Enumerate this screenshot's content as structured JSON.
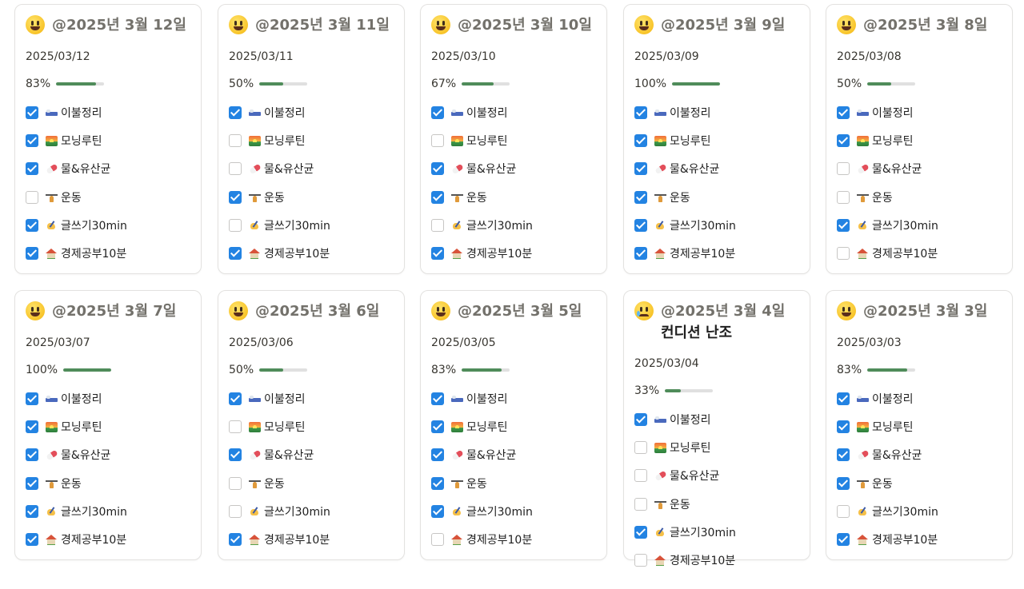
{
  "checklist_items": [
    {
      "label": "이불정리",
      "icon": "bed-icon"
    },
    {
      "label": "모닝루틴",
      "icon": "sunrise-icon"
    },
    {
      "label": "물&유산균",
      "icon": "pill-icon"
    },
    {
      "label": "운동",
      "icon": "weight-lifter-icon"
    },
    {
      "label": "글쓰기30min",
      "icon": "writing-hand-icon"
    },
    {
      "label": "경제공부10분",
      "icon": "house-icon"
    }
  ],
  "colors": {
    "checkbox_checked": "#2383e2",
    "progress_fill": "#4f8c5a",
    "progress_track": "#e0e0e0",
    "title_gray": "#73716b"
  },
  "cards": [
    {
      "title": "@2025년 3월 12일",
      "title_suffix": "",
      "mood": "grinning-face-icon",
      "date": "2025/03/12",
      "progress_label": "83%",
      "progress": 0.83,
      "checks": [
        true,
        true,
        true,
        false,
        true,
        true
      ]
    },
    {
      "title": "@2025년 3월 11일",
      "title_suffix": "",
      "mood": "grinning-face-icon",
      "date": "2025/03/11",
      "progress_label": "50%",
      "progress": 0.5,
      "checks": [
        true,
        false,
        false,
        true,
        false,
        true
      ]
    },
    {
      "title": "@2025년 3월 10일",
      "title_suffix": "",
      "mood": "grinning-face-icon",
      "date": "2025/03/10",
      "progress_label": "67%",
      "progress": 0.67,
      "checks": [
        true,
        false,
        true,
        true,
        false,
        true
      ]
    },
    {
      "title": "@2025년 3월 9일",
      "title_suffix": "",
      "mood": "grinning-face-icon",
      "date": "2025/03/09",
      "progress_label": "100%",
      "progress": 1.0,
      "checks": [
        true,
        true,
        true,
        true,
        true,
        true
      ]
    },
    {
      "title": "@2025년 3월 8일",
      "title_suffix": "",
      "mood": "grinning-face-icon",
      "date": "2025/03/08",
      "progress_label": "50%",
      "progress": 0.5,
      "checks": [
        true,
        true,
        false,
        false,
        true,
        false
      ]
    },
    {
      "title": "@2025년 3월 7일",
      "title_suffix": "",
      "mood": "grinning-face-icon",
      "date": "2025/03/07",
      "progress_label": "100%",
      "progress": 1.0,
      "checks": [
        true,
        true,
        true,
        true,
        true,
        true
      ]
    },
    {
      "title": "@2025년 3월 6일",
      "title_suffix": "",
      "mood": "grinning-face-icon",
      "date": "2025/03/06",
      "progress_label": "50%",
      "progress": 0.5,
      "checks": [
        true,
        false,
        true,
        false,
        false,
        true
      ]
    },
    {
      "title": "@2025년 3월 5일",
      "title_suffix": "",
      "mood": "grinning-face-icon",
      "date": "2025/03/05",
      "progress_label": "83%",
      "progress": 0.83,
      "checks": [
        true,
        true,
        true,
        true,
        true,
        false
      ]
    },
    {
      "title": "@2025년 3월 4일",
      "title_suffix": "컨디션 난조",
      "mood": "crying-face-icon",
      "date": "2025/03/04",
      "progress_label": "33%",
      "progress": 0.33,
      "checks": [
        true,
        false,
        false,
        false,
        true,
        false
      ]
    },
    {
      "title": "@2025년 3월 3일",
      "title_suffix": "",
      "mood": "grinning-face-icon",
      "date": "2025/03/03",
      "progress_label": "83%",
      "progress": 0.83,
      "checks": [
        true,
        true,
        true,
        true,
        false,
        true
      ]
    }
  ]
}
